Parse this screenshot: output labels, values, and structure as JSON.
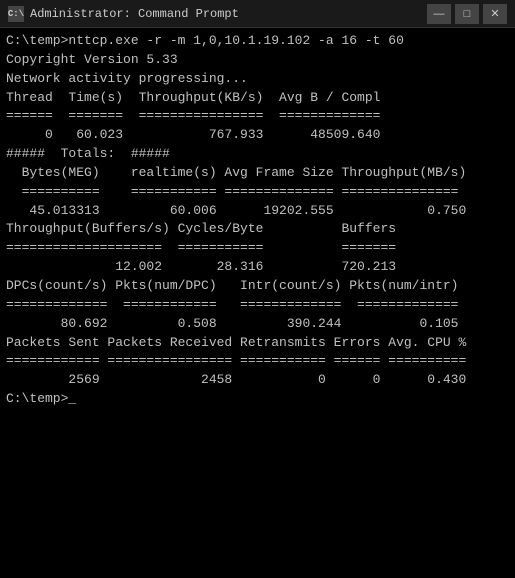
{
  "titleBar": {
    "icon": "C:\\",
    "title": "Administrator: Command Prompt",
    "minimize": "—",
    "maximize": "□",
    "close": "✕"
  },
  "terminal": {
    "lines": [
      "C:\\temp>nttcp.exe -r -m 1,0,10.1.19.102 -a 16 -t 60",
      "Copyright Version 5.33",
      "Network activity progressing...",
      "",
      "",
      "Thread  Time(s)  Throughput(KB/s)  Avg B / Compl",
      "======  =======  ================  =============",
      "     0   60.023           767.933      48509.640",
      "",
      "",
      "#####  Totals:  #####",
      "",
      "",
      "  Bytes(MEG)    realtime(s) Avg Frame Size Throughput(MB/s)",
      "  ==========    =========== ============== ===============",
      "   45.013313         60.006      19202.555            0.750",
      "",
      "",
      "Throughput(Buffers/s) Cycles/Byte          Buffers",
      "====================  ===========          =======",
      "              12.002       28.316          720.213",
      "",
      "",
      "DPCs(count/s) Pkts(num/DPC)   Intr(count/s) Pkts(num/intr)",
      "=============  ============   =============  =============",
      "       80.692         0.508         390.244          0.105",
      "",
      "",
      "Packets Sent Packets Received Retransmits Errors Avg. CPU %",
      "============ ================ =========== ====== ==========",
      "        2569             2458           0      0      0.430",
      "",
      "C:\\temp>_"
    ]
  }
}
